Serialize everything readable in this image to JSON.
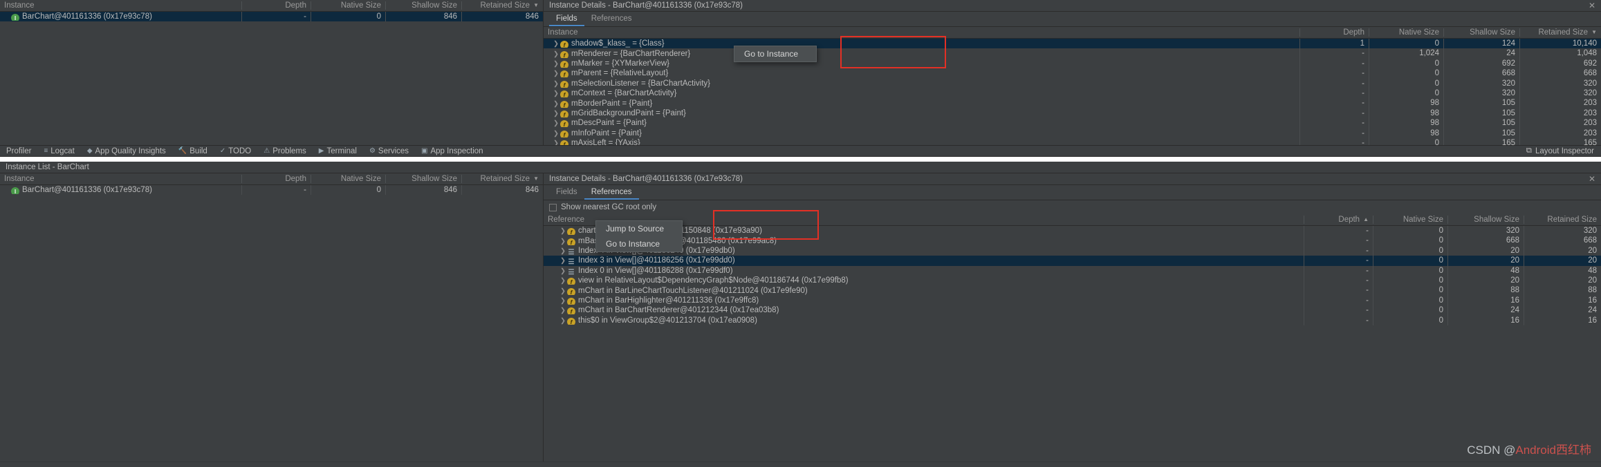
{
  "theme": {
    "bg": "#3c3f41",
    "selection": "#0d293e",
    "accent": "#4a88c7",
    "annotation_red": "#e33025",
    "field_icon": "#c9a227",
    "instance_icon": "#4a9a4a"
  },
  "top_panel": {
    "instance_table": {
      "columns": [
        "Instance",
        "Depth",
        "Native Size",
        "Shallow Size",
        "Retained Size"
      ],
      "sorted_column": "Retained Size",
      "sort_caret": "▼",
      "rows": [
        {
          "icon": "instance-icon",
          "name": "BarChart@401161336 (0x17e93c78)",
          "depth": "-",
          "native": "0",
          "shallow": "846",
          "retained": "846",
          "selected": true
        }
      ]
    },
    "details": {
      "title": "Instance Details - BarChart@401161336 (0x17e93c78)",
      "tabs": [
        {
          "label": "Fields",
          "active": true
        },
        {
          "label": "References",
          "active": false
        }
      ],
      "fields_table": {
        "columns": [
          "Instance",
          "Depth",
          "Native Size",
          "Shallow Size",
          "Retained Size"
        ],
        "sorted_column": "Retained Size",
        "sort_caret": "▼",
        "rows": [
          {
            "arrow": ">",
            "icon": "field-icon",
            "name": "shadow$_klass_ = {Class}",
            "depth": "1",
            "native": "0",
            "shallow": "124",
            "retained": "10,140",
            "selected": true
          },
          {
            "arrow": ">",
            "icon": "field-icon",
            "name": "mRenderer = {BarChartRenderer}",
            "depth": "-",
            "native": "1,024",
            "shallow": "24",
            "retained": "1,048",
            "selected": false
          },
          {
            "arrow": ">",
            "icon": "field-icon",
            "name": "mMarker = {XYMarkerView}",
            "depth": "-",
            "native": "0",
            "shallow": "692",
            "retained": "692",
            "selected": false
          },
          {
            "arrow": ">",
            "icon": "field-icon",
            "name": "mParent = {RelativeLayout}",
            "depth": "-",
            "native": "0",
            "shallow": "668",
            "retained": "668",
            "selected": false
          },
          {
            "arrow": ">",
            "icon": "field-icon",
            "name": "mSelectionListener = {BarChartActivity}",
            "depth": "-",
            "native": "0",
            "shallow": "320",
            "retained": "320",
            "selected": false
          },
          {
            "arrow": ">",
            "icon": "field-icon",
            "name": "mContext = {BarChartActivity}",
            "depth": "-",
            "native": "0",
            "shallow": "320",
            "retained": "320",
            "selected": false
          },
          {
            "arrow": ">",
            "icon": "field-icon",
            "name": "mBorderPaint = {Paint}",
            "depth": "-",
            "native": "98",
            "shallow": "105",
            "retained": "203",
            "selected": false
          },
          {
            "arrow": ">",
            "icon": "field-icon",
            "name": "mGridBackgroundPaint = {Paint}",
            "depth": "-",
            "native": "98",
            "shallow": "105",
            "retained": "203",
            "selected": false
          },
          {
            "arrow": ">",
            "icon": "field-icon",
            "name": "mDescPaint = {Paint}",
            "depth": "-",
            "native": "98",
            "shallow": "105",
            "retained": "203",
            "selected": false
          },
          {
            "arrow": ">",
            "icon": "field-icon",
            "name": "mInfoPaint = {Paint}",
            "depth": "-",
            "native": "98",
            "shallow": "105",
            "retained": "203",
            "selected": false
          },
          {
            "arrow": ">",
            "icon": "field-icon",
            "name": "mAxisLeft = {YAxis}",
            "depth": "-",
            "native": "0",
            "shallow": "165",
            "retained": "165",
            "selected": false
          }
        ]
      },
      "context_menu": {
        "items": [
          "Go to Instance"
        ]
      }
    }
  },
  "ide_strip": {
    "items": [
      {
        "label": "Profiler",
        "icon": ""
      },
      {
        "label": "Logcat",
        "icon": "≡"
      },
      {
        "label": "App Quality Insights",
        "icon": "◆"
      },
      {
        "label": "Build",
        "icon": "🔨"
      },
      {
        "label": "TODO",
        "icon": "✓"
      },
      {
        "label": "Problems",
        "icon": "⚠"
      },
      {
        "label": "Terminal",
        "icon": "▶"
      },
      {
        "label": "Services",
        "icon": "⚙"
      },
      {
        "label": "App Inspection",
        "icon": "▣"
      }
    ],
    "right": {
      "label": "Layout Inspector",
      "icon": "⧉"
    }
  },
  "bottom_panel": {
    "title": "Instance List - BarChart",
    "instance_table": {
      "columns": [
        "Instance",
        "Depth",
        "Native Size",
        "Shallow Size",
        "Retained Size"
      ],
      "sorted_column": "Retained Size",
      "sort_caret": "▼",
      "rows": [
        {
          "icon": "instance-icon",
          "name": "BarChart@401161336 (0x17e93c78)",
          "depth": "-",
          "native": "0",
          "shallow": "846",
          "retained": "846",
          "selected": false
        }
      ]
    },
    "details": {
      "title": "Instance Details - BarChart@401161336 (0x17e93c78)",
      "tabs": [
        {
          "label": "Fields",
          "active": false
        },
        {
          "label": "References",
          "active": true
        }
      ],
      "gc_root_checkbox": {
        "label": "Show nearest GC root only",
        "checked": false
      },
      "references_table": {
        "columns": [
          "Reference",
          "Depth",
          "Native Size",
          "Shallow Size",
          "Retained Size"
        ],
        "sorted_column": "Depth",
        "sort_caret": "▲",
        "rows": [
          {
            "arrow": ">",
            "icon": "field-icon",
            "name": "chart in BarChartActivity@401150848 (0x17e93a90)",
            "depth": "-",
            "native": "0",
            "shallow": "320",
            "retained": "320",
            "selected": false
          },
          {
            "arrow": ">",
            "icon": "field-icon",
            "name": "mBaseline in RelativeLayout@401185480 (0x17e99ac8)",
            "depth": "-",
            "native": "0",
            "shallow": "668",
            "retained": "668",
            "selected": false
          },
          {
            "arrow": ">",
            "icon": "array-icon",
            "name": "Index 4 in View[]@401186240 (0x17e99db0)",
            "depth": "-",
            "native": "0",
            "shallow": "20",
            "retained": "20",
            "selected": false
          },
          {
            "arrow": ">",
            "icon": "array-icon",
            "name": "Index 3 in View[]@401186256 (0x17e99dd0)",
            "depth": "-",
            "native": "0",
            "shallow": "20",
            "retained": "20",
            "selected": true
          },
          {
            "arrow": ">",
            "icon": "array-icon",
            "name": "Index 0 in View[]@401186288 (0x17e99df0)",
            "depth": "-",
            "native": "0",
            "shallow": "48",
            "retained": "48",
            "selected": false
          },
          {
            "arrow": ">",
            "icon": "field-icon",
            "name": "view in RelativeLayout$DependencyGraph$Node@401186744 (0x17e99fb8)",
            "depth": "-",
            "native": "0",
            "shallow": "20",
            "retained": "20",
            "selected": false
          },
          {
            "arrow": ">",
            "icon": "field-icon",
            "name": "mChart in BarLineChartTouchListener@401211024 (0x17e9fe90)",
            "depth": "-",
            "native": "0",
            "shallow": "88",
            "retained": "88",
            "selected": false
          },
          {
            "arrow": ">",
            "icon": "field-icon",
            "name": "mChart in BarHighlighter@401211336 (0x17e9ffc8)",
            "depth": "-",
            "native": "0",
            "shallow": "16",
            "retained": "16",
            "selected": false
          },
          {
            "arrow": ">",
            "icon": "field-icon",
            "name": "mChart in BarChartRenderer@401212344 (0x17ea03b8)",
            "depth": "-",
            "native": "0",
            "shallow": "24",
            "retained": "24",
            "selected": false
          },
          {
            "arrow": ">",
            "icon": "field-icon",
            "name": "this$0 in ViewGroup$2@401213704 (0x17ea0908)",
            "depth": "-",
            "native": "0",
            "shallow": "16",
            "retained": "16",
            "selected": false
          }
        ]
      },
      "context_menu": {
        "items": [
          "Jump to Source",
          "Go to Instance"
        ]
      }
    }
  },
  "watermark": {
    "prefix": "CSDN ",
    "at": "@",
    "text": "Android西红柿"
  }
}
